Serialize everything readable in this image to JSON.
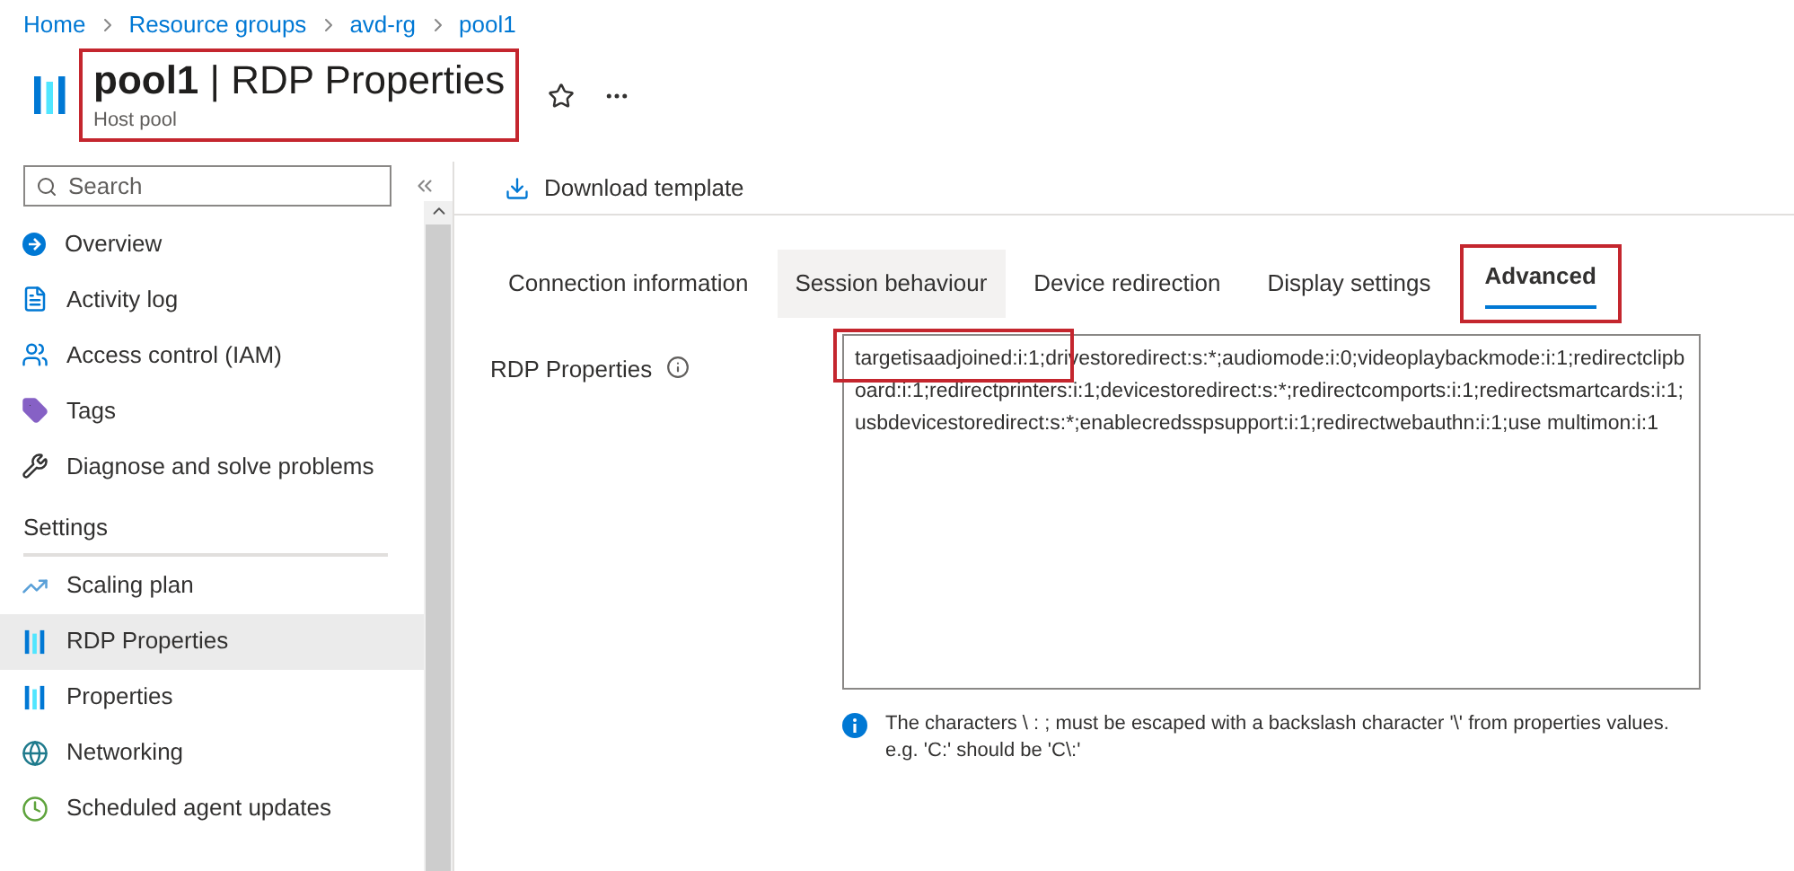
{
  "breadcrumb": [
    "Home",
    "Resource groups",
    "avd-rg",
    "pool1"
  ],
  "header": {
    "name": "pool1",
    "separator": "|",
    "title": "RDP Properties",
    "subtitle": "Host pool",
    "highlighted": true
  },
  "search": {
    "placeholder": "Search"
  },
  "sidebar": {
    "items": [
      {
        "label": "Overview",
        "selected": false
      },
      {
        "label": "Activity log",
        "selected": false
      },
      {
        "label": "Access control (IAM)",
        "selected": false
      },
      {
        "label": "Tags",
        "selected": false
      },
      {
        "label": "Diagnose and solve problems",
        "selected": false
      }
    ],
    "section": "Settings",
    "settings_items": [
      {
        "label": "Scaling plan",
        "selected": false
      },
      {
        "label": "RDP Properties",
        "selected": true
      },
      {
        "label": "Properties",
        "selected": false
      },
      {
        "label": "Networking",
        "selected": false
      },
      {
        "label": "Scheduled agent updates",
        "selected": false
      }
    ]
  },
  "toolbar": {
    "download": "Download template"
  },
  "tabs": [
    {
      "label": "Connection information",
      "selected": false,
      "hovered": false,
      "highlighted": false
    },
    {
      "label": "Session behaviour",
      "selected": false,
      "hovered": true,
      "highlighted": false
    },
    {
      "label": "Device redirection",
      "selected": false,
      "hovered": false,
      "highlighted": false
    },
    {
      "label": "Display settings",
      "selected": false,
      "hovered": false,
      "highlighted": false
    },
    {
      "label": "Advanced",
      "selected": true,
      "hovered": false,
      "highlighted": true
    }
  ],
  "field": {
    "label": "RDP Properties",
    "highlighted": true,
    "value": "targetisaadjoined:i:1;drivestoredirect:s:*;audiomode:i:0;videoplaybackmode:i:1;redirectclipboard:i:1;redirectprinters:i:1;devicestoredirect:s:*;redirectcomports:i:1;redirectsmartcards:i:1;usbdevicestoredirect:s:*;enablecredsspsupport:i:1;redirectwebauthn:i:1;use multimon:i:1"
  },
  "info": "The characters \\ : ; must be escaped with a backslash character '\\' from properties values. e.g. 'C:' should be 'C\\:'"
}
